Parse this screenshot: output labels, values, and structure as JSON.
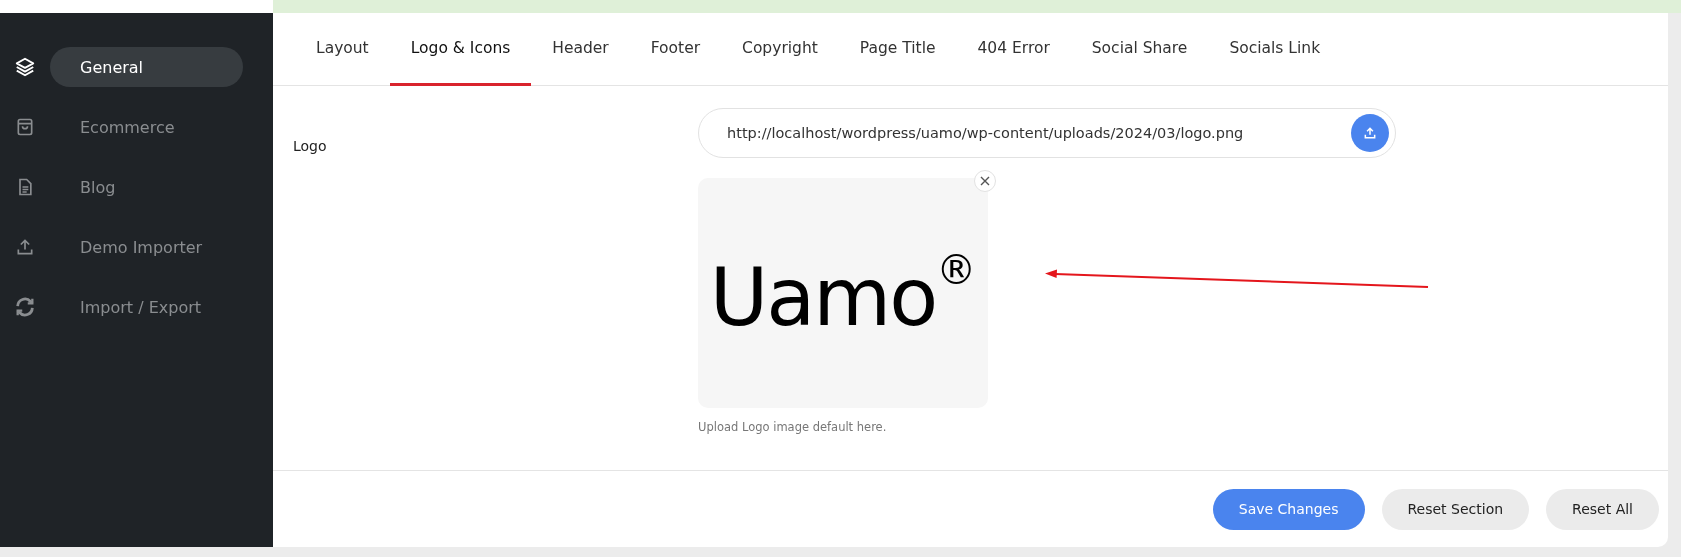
{
  "sidebar": {
    "items": [
      {
        "label": "General",
        "selected": true
      },
      {
        "label": "Ecommerce",
        "selected": false
      },
      {
        "label": "Blog",
        "selected": false
      },
      {
        "label": "Demo Importer",
        "selected": false
      },
      {
        "label": "Import / Export",
        "selected": false
      }
    ]
  },
  "tabs": [
    {
      "label": "Layout",
      "selected": false
    },
    {
      "label": "Logo & Icons",
      "selected": true
    },
    {
      "label": "Header",
      "selected": false
    },
    {
      "label": "Footer",
      "selected": false
    },
    {
      "label": "Copyright",
      "selected": false
    },
    {
      "label": "Page Title",
      "selected": false
    },
    {
      "label": "404 Error",
      "selected": false
    },
    {
      "label": "Social Share",
      "selected": false
    },
    {
      "label": "Socials Link",
      "selected": false
    }
  ],
  "logo_field": {
    "label": "Logo",
    "value": "http://localhost/wordpress/uamo/wp-content/uploads/2024/03/logo.png",
    "preview_text": "Uamo$^{®}$",
    "help": "Upload Logo image default here."
  },
  "buttons": [
    {
      "label": "Save Changes",
      "kind": "primary"
    },
    {
      "label": "Reset Section",
      "kind": "secondary"
    },
    {
      "label": "Reset All",
      "kind": "secondary"
    }
  ]
}
